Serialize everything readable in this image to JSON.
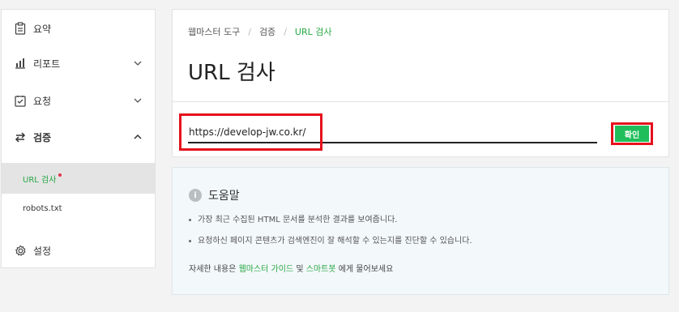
{
  "sidebar": {
    "items": [
      {
        "label": "요약",
        "icon": "clipboard-icon"
      },
      {
        "label": "리포트",
        "icon": "bar-chart-icon"
      },
      {
        "label": "요청",
        "icon": "checkbox-icon"
      },
      {
        "label": "검증",
        "icon": "sync-arrows-icon"
      },
      {
        "label": "설정",
        "icon": "gear-icon"
      }
    ],
    "sub_items": [
      {
        "label": "URL 검사"
      },
      {
        "label": "robots.txt"
      }
    ]
  },
  "breadcrumb": [
    "웹마스터 도구",
    "검증",
    "URL 검사"
  ],
  "breadcrumb_sep": "/",
  "page_title": "URL 검사",
  "url_input": {
    "value": "https://develop-jw.co.kr/"
  },
  "confirm_label": "확인",
  "help": {
    "title": "도움말",
    "info_glyph": "i",
    "bullets": [
      "가장 최근 수집된 HTML 문서를 분석한 결과를 보여줍니다.",
      "요청하신 페이지 콘텐츠가 검색엔진이 잘 해석할 수 있는지를 진단할 수 있습니다."
    ],
    "footer": {
      "pre": "자세한 내용은 ",
      "link1": "웹마스터 가이드",
      "mid": " 및 ",
      "link2": "스마트봇",
      "post": " 에게 물어보세요"
    }
  },
  "colors": {
    "accent": "#28a745",
    "button": "#1fbe5a",
    "highlight": "#e5121d"
  }
}
